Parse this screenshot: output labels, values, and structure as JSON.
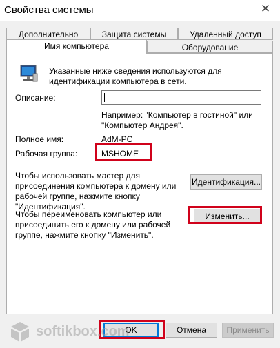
{
  "window": {
    "title": "Свойства системы",
    "close_glyph": "✕"
  },
  "tabs": {
    "top_row": [
      "Дополнительно",
      "Защита системы",
      "Удаленный доступ"
    ],
    "bottom_row": [
      "Имя компьютера",
      "Оборудование"
    ],
    "active": "Имя компьютера"
  },
  "content": {
    "intro_text": "Указанные ниже сведения используются для\nидентификации компьютера в сети.",
    "description_label": "Описание:",
    "description_value": "",
    "example_text": "Например: \"Компьютер в гостиной\" или\n\"Компьютер Андрея\".",
    "fullname_label": "Полное имя:",
    "fullname_value": "AdM-PC",
    "workgroup_label": "Рабочая группа:",
    "workgroup_value": "MSHOME",
    "identification_text": "Чтобы использовать мастер для\nприсоединения компьютера к домену или\nрабочей группе, нажмите кнопку\n\"Идентификация\".",
    "identification_button": "Идентификация...",
    "rename_text": "Чтобы переименовать компьютер или\nприсоединить его к домену или рабочей\nгруппе, нажмите кнопку \"Изменить\".",
    "change_button": "Изменить..."
  },
  "footer": {
    "ok": "OK",
    "cancel": "Отмена",
    "apply": "Применить"
  },
  "watermark": {
    "text": "softikbox.com"
  },
  "colors": {
    "highlight": "#d0021b",
    "accent": "#0078d7"
  }
}
